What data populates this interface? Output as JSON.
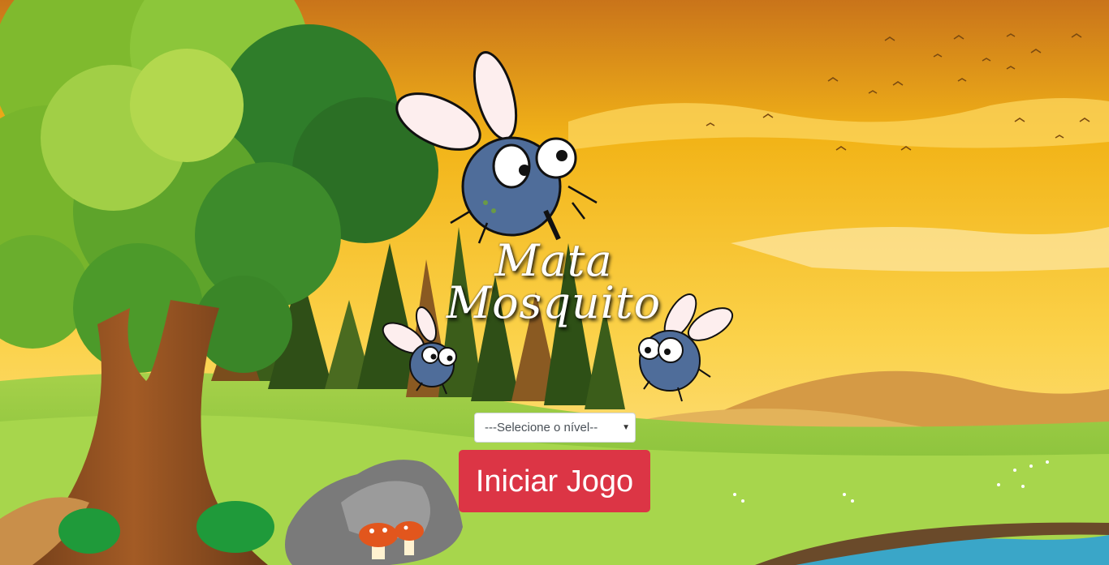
{
  "game": {
    "title_line1": "Mata",
    "title_line2": "Mosquito"
  },
  "level_select": {
    "value": "---Selecione o nível--",
    "caret_icon": "▼"
  },
  "start_button": {
    "label": "Iniciar Jogo"
  },
  "colors": {
    "button_bg": "#dc3545",
    "sky_top": "#d98a1e",
    "sky_bottom": "#fbd56a",
    "grass": "#8dc63f",
    "mosquito_body": "#4f6d9a"
  },
  "icons": [
    "mosquito-icon",
    "tree-icon",
    "mushroom-icon",
    "rock-icon",
    "bird-icon"
  ]
}
